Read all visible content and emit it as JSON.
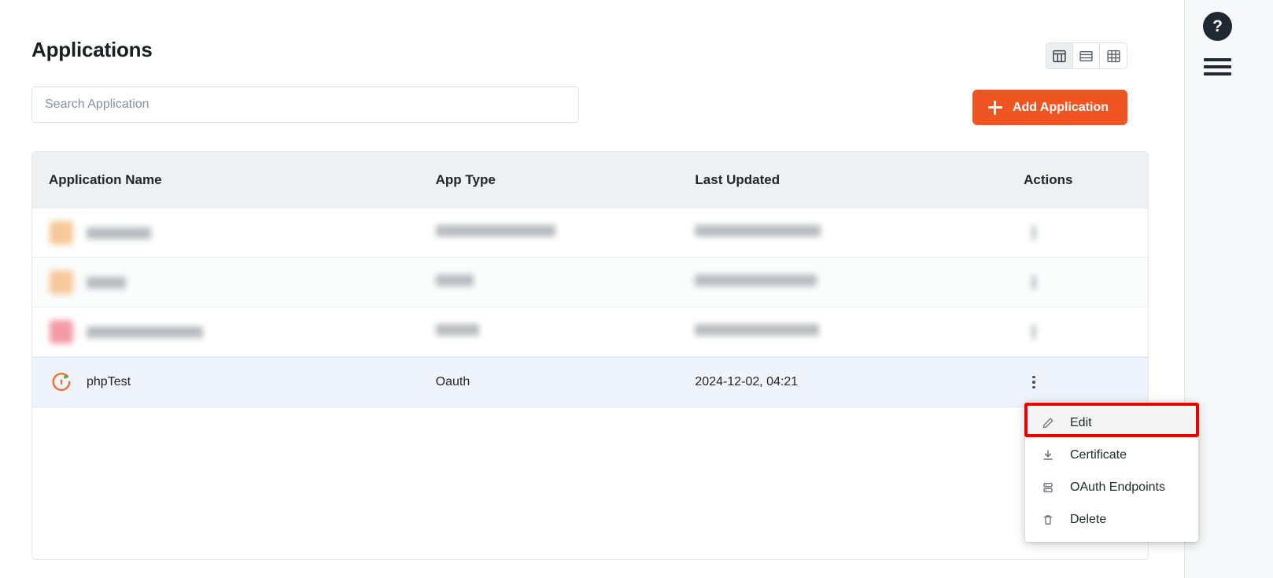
{
  "page": {
    "title": "Applications"
  },
  "search": {
    "placeholder": "Search Application",
    "value": ""
  },
  "toolbar": {
    "add_label": "Add Application",
    "accent_color": "#ee5522",
    "view_modes": [
      {
        "name": "split-view",
        "icon": "table-split-icon",
        "active": true
      },
      {
        "name": "list-view",
        "icon": "list-rows-icon",
        "active": false
      },
      {
        "name": "grid-view",
        "icon": "grid-icon",
        "active": false
      }
    ]
  },
  "table": {
    "columns": [
      "Application Name",
      "App Type",
      "Last Updated",
      "Actions"
    ],
    "rows": [
      {
        "name": "",
        "app_type": "",
        "last_updated": "",
        "redacted": true,
        "icon_color": "#f6c89a",
        "name_bar_width": 82,
        "type_bar_width": 152,
        "date_bar_width": 160
      },
      {
        "name": "",
        "app_type": "",
        "last_updated": "",
        "redacted": true,
        "icon_color": "#f6c89a",
        "name_bar_width": 50,
        "type_bar_width": 48,
        "date_bar_width": 155
      },
      {
        "name": "",
        "app_type": "",
        "last_updated": "",
        "redacted": true,
        "icon_color": "#f49ba6",
        "name_bar_width": 148,
        "type_bar_width": 55,
        "date_bar_width": 158
      },
      {
        "name": "phpTest",
        "app_type": "Oauth",
        "last_updated": "2024-12-02, 04:21",
        "redacted": false,
        "icon_color": "#ee7230",
        "selected": true
      }
    ]
  },
  "actions_menu": {
    "open": true,
    "highlight_color": "#ee0000",
    "items": [
      {
        "label": "Edit",
        "icon": "pencil-icon",
        "highlighted": true
      },
      {
        "label": "Certificate",
        "icon": "download-icon",
        "highlighted": false
      },
      {
        "label": "OAuth Endpoints",
        "icon": "server-stack-icon",
        "highlighted": false
      },
      {
        "label": "Delete",
        "icon": "trash-icon",
        "highlighted": false
      }
    ]
  },
  "right_rail": {
    "help_label": "?",
    "menu_label": "menu"
  }
}
